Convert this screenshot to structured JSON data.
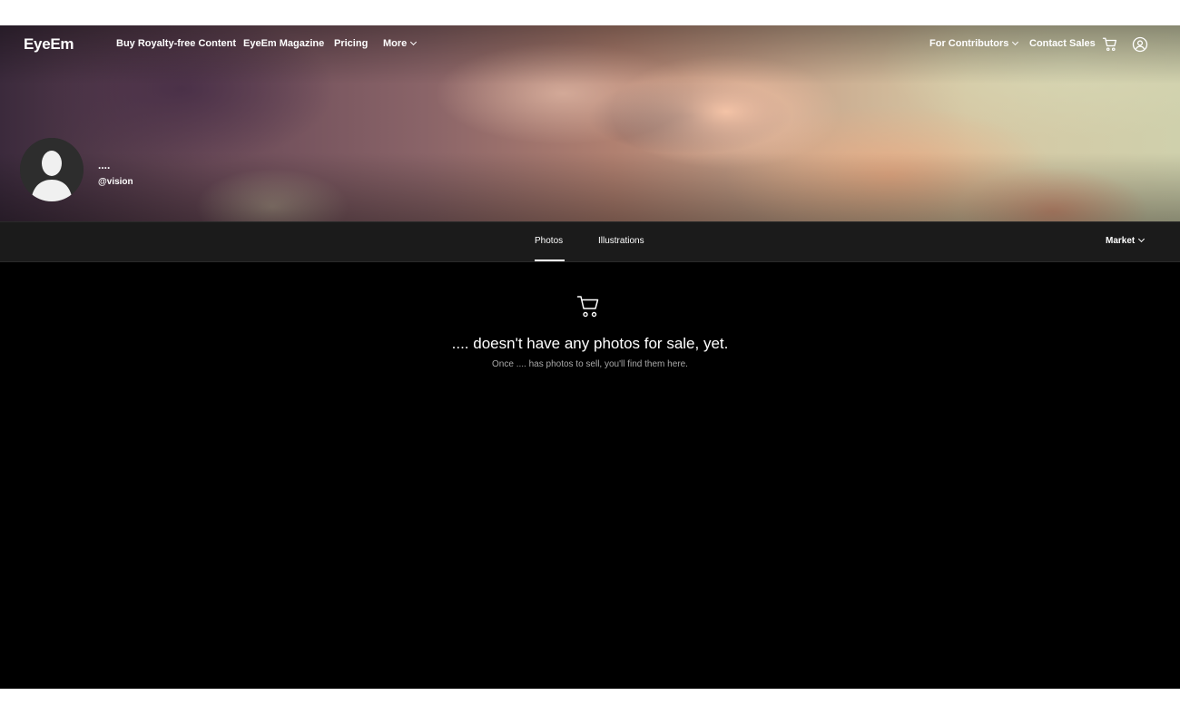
{
  "nav": {
    "logo": "EyeEm",
    "links": [
      "Buy Royalty-free Content",
      "EyeEm Magazine",
      "Pricing",
      "More"
    ],
    "right_links": [
      "For Contributors",
      "Contact Sales"
    ],
    "icons": [
      "cart-icon",
      "account-icon",
      "chevron-down-icon"
    ]
  },
  "profile": {
    "name": "....",
    "handle": "@vision"
  },
  "tabs": [
    {
      "label": "Photos",
      "active": true
    },
    {
      "label": "Illustrations",
      "active": false
    }
  ],
  "filter": {
    "label": "Market"
  },
  "empty_state": {
    "icon": "cart-icon",
    "title": ".... doesn't have any photos for sale, yet.",
    "subtitle": "Once .... has photos to sell, you'll find them here."
  },
  "colors": {
    "background": "#000000",
    "tabbar": "#1b1b1b",
    "text": "#ffffff",
    "muted_text": "#a9a9a9"
  }
}
